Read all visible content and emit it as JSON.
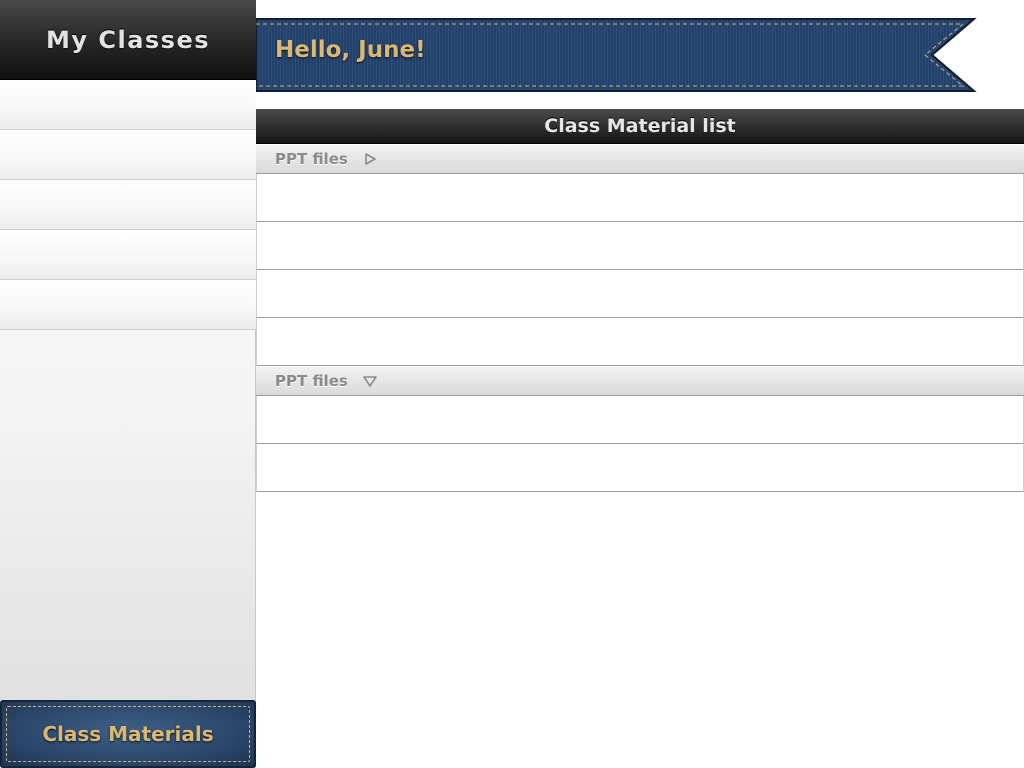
{
  "sidebar": {
    "title": "My Classes",
    "items": [
      {
        "label": ""
      },
      {
        "label": ""
      },
      {
        "label": ""
      },
      {
        "label": ""
      },
      {
        "label": ""
      }
    ],
    "footer_button_label": "Class Materials"
  },
  "greeting": {
    "text": "Hello, June!"
  },
  "content": {
    "title": "Class Material list",
    "sections": [
      {
        "label": "PPT files",
        "arrow_icon": "triangle-right-icon",
        "state": "collapsed",
        "rows": 4
      },
      {
        "label": "PPT files",
        "arrow_icon": "triangle-down-icon",
        "state": "expanded",
        "rows": 2
      }
    ]
  },
  "colors": {
    "denim_blue": "#2d4a6e",
    "gold_text": "#d8b873",
    "header_dark": "#262626",
    "section_label_gray": "#8a8a8a"
  }
}
